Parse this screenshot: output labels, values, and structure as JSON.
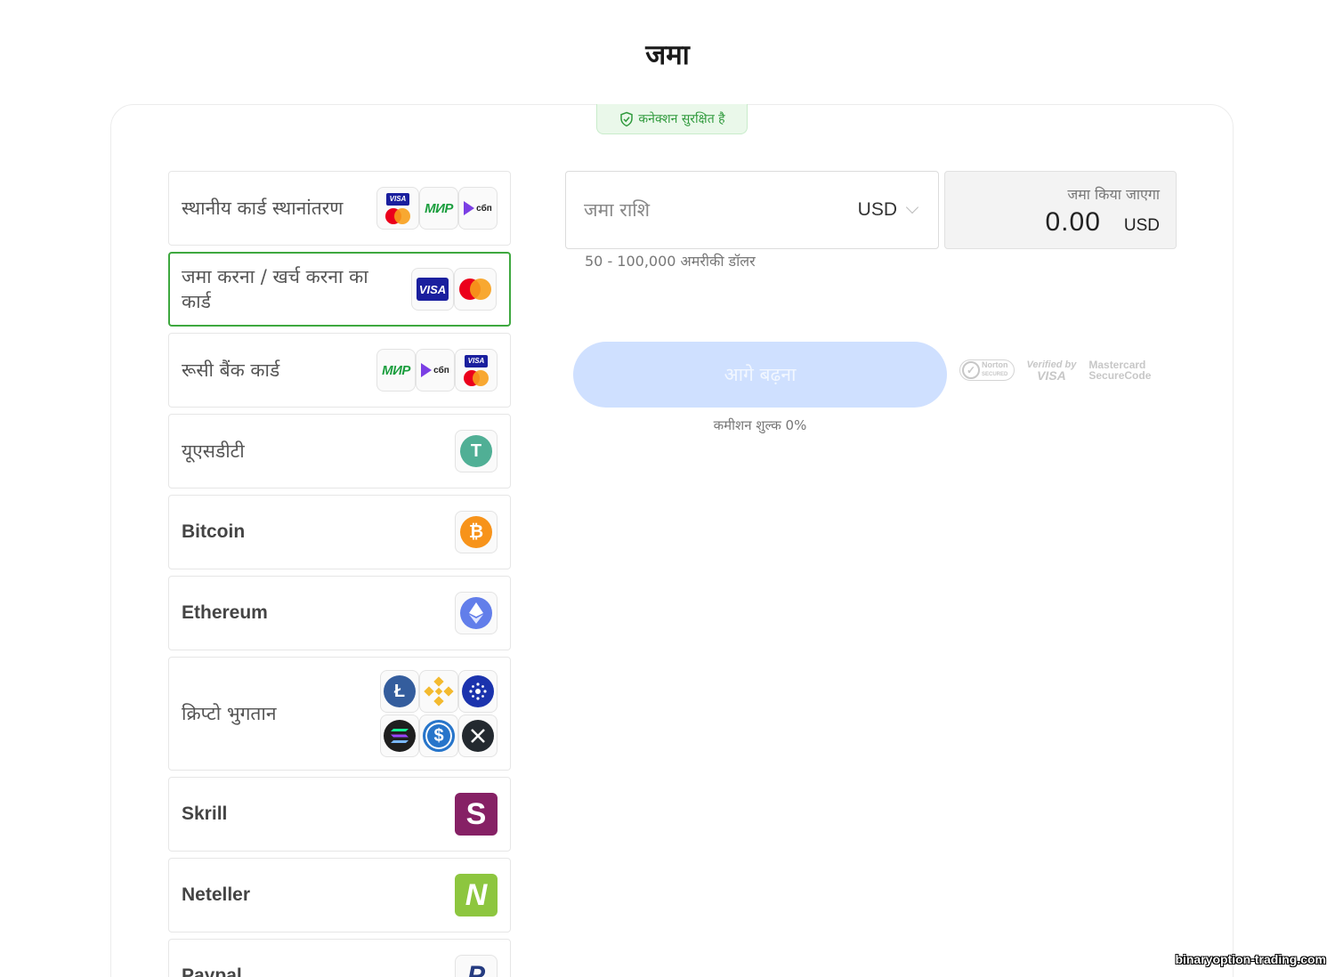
{
  "page": {
    "title": "जमा",
    "secure_badge": "कनेक्शन सुरक्षित है"
  },
  "methods": [
    {
      "label": "स्थानीय कार्ड स्थानांतरण",
      "logos": [
        "visa",
        "mastercard",
        "mir",
        "sbp"
      ],
      "selected": false
    },
    {
      "label": "जमा करना / खर्च करना का कार्ड",
      "logos": [
        "visa",
        "mastercard"
      ],
      "selected": true
    },
    {
      "label": "रूसी बैंक कार्ड",
      "logos": [
        "mir",
        "sbp",
        "visa",
        "mastercard"
      ],
      "selected": false
    },
    {
      "label": "यूएसडीटी",
      "logos": [
        "tether"
      ],
      "selected": false
    },
    {
      "label": "Bitcoin",
      "logos": [
        "bitcoin"
      ],
      "selected": false
    },
    {
      "label": "Ethereum",
      "logos": [
        "ethereum"
      ],
      "selected": false
    },
    {
      "label": "क्रिप्टो भुगतान",
      "logos": [
        "litecoin",
        "binance",
        "cardano",
        "solana",
        "usdc",
        "xrp"
      ],
      "selected": false
    },
    {
      "label": "Skrill",
      "logos": [
        "skrill"
      ],
      "selected": false
    },
    {
      "label": "Neteller",
      "logos": [
        "neteller"
      ],
      "selected": false
    },
    {
      "label": "Paypal",
      "logos": [
        "paypal"
      ],
      "selected": false
    }
  ],
  "logo_text": {
    "visa": "VISA",
    "mir": "МИР",
    "sbp": "сбп",
    "tether": "T",
    "bitcoin": "₿",
    "litecoin": "Ł",
    "usdc": "$",
    "skrill": "S",
    "neteller": "N",
    "paypal": "P"
  },
  "amount": {
    "placeholder": "जमा राशि",
    "value": "",
    "currency": "USD",
    "range_hint": "50 - 100,000 अमरीकी डॉलर"
  },
  "total": {
    "label": "जमा किया जाएगा",
    "value": "0.00",
    "currency": "USD"
  },
  "continue_label": "आगे बढ़ना",
  "commission": "कमीशन शुल्क 0%",
  "trust": {
    "norton_line1": "Norton",
    "norton_line2": "SECURED",
    "vbv_line1": "Verified by",
    "vbv_line2": "VISA",
    "mc_line1": "Mastercard",
    "mc_line2": "SecureCode"
  },
  "watermark": "binaryoption-trading.com",
  "colors": {
    "selected_border": "#3ea83f",
    "button_disabled": "#cfe0ff",
    "secure_green": "#2f9a3c"
  }
}
